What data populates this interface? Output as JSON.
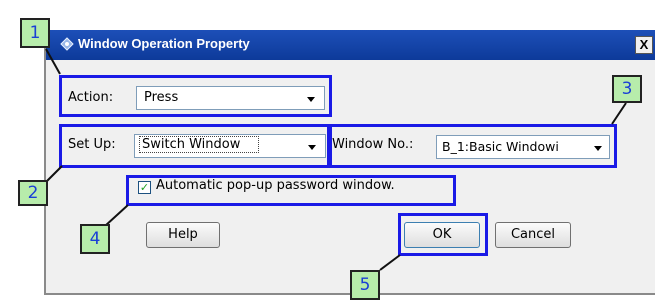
{
  "dialog": {
    "title": "Window Operation Property",
    "close_glyph": "X",
    "title_icon": "app-icon"
  },
  "action": {
    "label": "Action:",
    "value": "Press"
  },
  "setup": {
    "label": "Set Up:",
    "value": "Switch Window"
  },
  "window_no": {
    "label": "Window No.:",
    "value": "B_1:Basic Windowi"
  },
  "password": {
    "checked": true,
    "label": "Automatic pop-up password window."
  },
  "buttons": {
    "help": "Help",
    "ok": "OK",
    "cancel": "Cancel"
  },
  "callouts": {
    "c1": "1",
    "c2": "2",
    "c3": "3",
    "c4": "4",
    "c5": "5"
  },
  "colors": {
    "highlight": "#1a1ae6",
    "callout_fill": "#b7ecab",
    "titlebar": "#0d3a9a"
  }
}
